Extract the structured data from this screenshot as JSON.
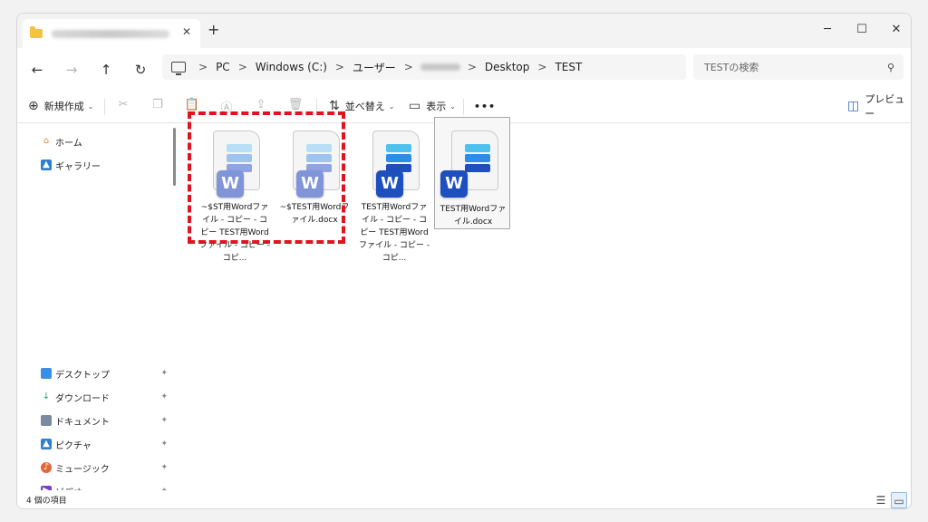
{
  "tab": {
    "title": "██████████████████"
  },
  "window_controls": {
    "minimize": "─",
    "maximize": "☐",
    "close": "✕"
  },
  "nav": {
    "back": "←",
    "forward": "→",
    "up": "↑",
    "refresh": "↻"
  },
  "breadcrumb": [
    "PC",
    "Windows (C:)",
    "ユーザー",
    "Desktop",
    "TEST"
  ],
  "breadcrumb_sep": ">",
  "search": {
    "placeholder": "TESTの検索"
  },
  "toolbar": {
    "new_label": "新規作成",
    "sort_label": "並べ替え",
    "view_label": "表示",
    "more_label": "•••",
    "preview_label": "プレビュー"
  },
  "sidebar": {
    "top_items": [
      {
        "label": "ホーム",
        "icon": "home-icon"
      },
      {
        "label": "ギャラリー",
        "icon": "gallery-icon"
      }
    ],
    "pinned_items": [
      {
        "label": "デスクトップ",
        "icon": "desktop-icon"
      },
      {
        "label": "ダウンロード",
        "icon": "download-icon"
      },
      {
        "label": "ドキュメント",
        "icon": "document-icon"
      },
      {
        "label": "ピクチャ",
        "icon": "pictures-icon"
      },
      {
        "label": "ミュージック",
        "icon": "music-icon"
      },
      {
        "label": "ビデオ",
        "icon": "video-icon"
      }
    ]
  },
  "files": [
    {
      "name": "~$ST用Wordファイル - コピー - コピー TEST用Wordファイル - コピー - コピ...",
      "temp": true,
      "selected": false
    },
    {
      "name": "~$TEST用Wordファイル.docx",
      "temp": true,
      "selected": false
    },
    {
      "name": "TEST用Wordファイル - コピー - コピー TEST用Wordファイル - コピー - コピ...",
      "temp": false,
      "selected": false
    },
    {
      "name": "TEST用Wordファイル.docx",
      "temp": false,
      "selected": true
    }
  ],
  "badge_letter": "W",
  "status": {
    "count_text": "4 個の項目"
  },
  "colors": {
    "word_dark": "#1d4fbf",
    "word_light": "#7f95d8",
    "highlight": "#e0141e"
  }
}
